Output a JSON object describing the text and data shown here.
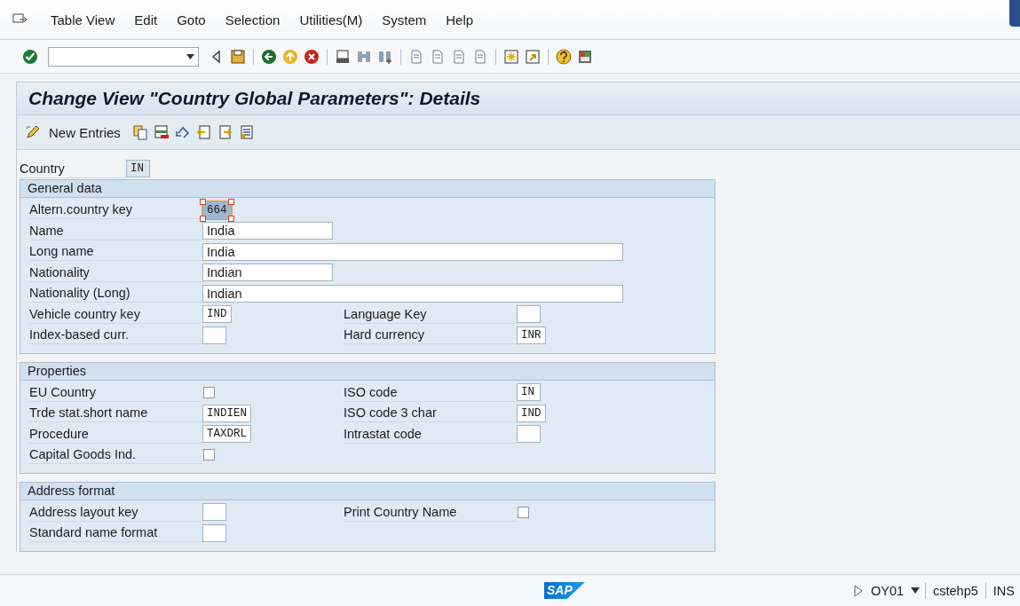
{
  "menu_bar": {
    "items": [
      "Table View",
      "Edit",
      "Goto",
      "Selection",
      "Utilities(M)",
      "System",
      "Help"
    ]
  },
  "title": "Change View \"Country Global Parameters\": Details",
  "app_toolbar": {
    "new_entries": "New Entries"
  },
  "country": {
    "label": "Country",
    "value": "IN",
    "kind": "code",
    "display_only": true,
    "selected": false
  },
  "groups": [
    {
      "title": "General data",
      "rows": [
        [
          {
            "label": "Altern.country key",
            "value": "664",
            "kind": "code",
            "display_only": true,
            "selected": true
          }
        ],
        [
          {
            "label": "Name",
            "value": "India",
            "kind": "text",
            "display_only": false,
            "selected": false
          }
        ],
        [
          {
            "label": "Long name",
            "value": "India",
            "kind": "long",
            "display_only": false,
            "selected": false
          }
        ],
        [
          {
            "label": "Nationality",
            "value": "Indian",
            "kind": "text",
            "display_only": false,
            "selected": false
          }
        ],
        [
          {
            "label": "Nationality (Long)",
            "value": "Indian",
            "kind": "long",
            "display_only": false,
            "selected": false
          }
        ],
        [
          {
            "label": "Vehicle country key",
            "value": "IND",
            "kind": "code",
            "display_only": false,
            "selected": false
          },
          {
            "label": "Language Key",
            "kind": "code",
            "display_only": false,
            "selected": false
          }
        ],
        [
          {
            "label": "Index-based curr.",
            "kind": "code",
            "display_only": false,
            "selected": false
          },
          {
            "label": "Hard currency",
            "value": "INR",
            "kind": "code",
            "display_only": false,
            "selected": false
          }
        ]
      ]
    },
    {
      "title": "Properties",
      "rows": [
        [
          {
            "label": "EU Country",
            "kind": "checkbox",
            "checked": false
          },
          {
            "label": "ISO code",
            "value": "IN",
            "kind": "code",
            "display_only": false,
            "selected": false
          }
        ],
        [
          {
            "label": "Trde stat.short name",
            "value": "INDIEN",
            "kind": "code",
            "display_only": false,
            "selected": false
          },
          {
            "label": "ISO code 3 char",
            "value": "IND",
            "kind": "code",
            "display_only": false,
            "selected": false
          }
        ],
        [
          {
            "label": "Procedure",
            "value": "TAXDRL",
            "kind": "code",
            "display_only": false,
            "selected": false
          },
          {
            "label": "Intrastat code",
            "kind": "code",
            "display_only": false,
            "selected": false
          }
        ],
        [
          {
            "label": "Capital Goods Ind.",
            "kind": "checkbox",
            "checked": false
          }
        ]
      ]
    },
    {
      "title": "Address format",
      "rows": [
        [
          {
            "label": "Address layout key",
            "kind": "code",
            "display_only": false,
            "selected": false
          },
          {
            "label": "Print Country Name",
            "kind": "checkbox",
            "checked": false
          }
        ],
        [
          {
            "label": "Standard name format",
            "kind": "code",
            "display_only": false,
            "selected": false
          }
        ]
      ]
    }
  ],
  "status_bar": {
    "logo": "SAP",
    "transaction": "OY01",
    "server": "cstehp5",
    "mode": "INS"
  }
}
